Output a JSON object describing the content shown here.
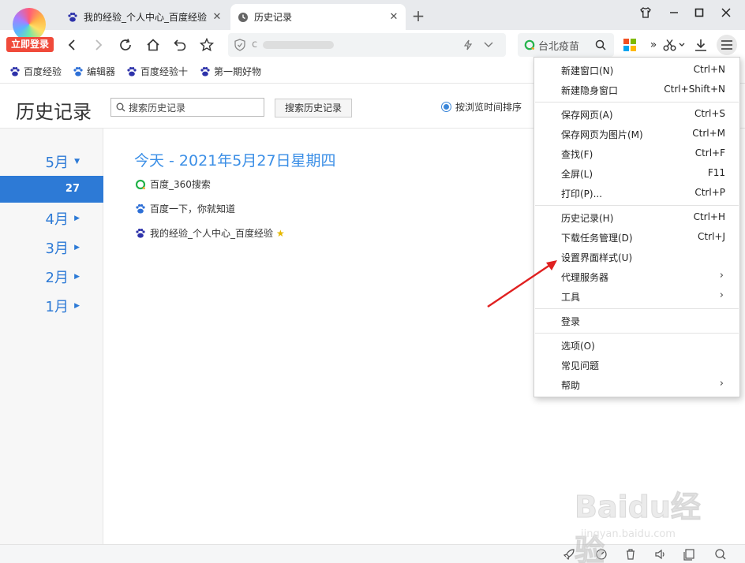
{
  "badge": {
    "login": "立即登录"
  },
  "tabs": [
    {
      "title": "我的经验_个人中心_百度经验",
      "icon": "baidu-paw-icon"
    },
    {
      "title": "历史记录",
      "icon": "clock-icon"
    }
  ],
  "toolbar": {
    "address_text": "c",
    "search_text": "台北疫苗",
    "more_label": "»"
  },
  "bookmarks": [
    {
      "label": "百度经验"
    },
    {
      "label": "编辑器"
    },
    {
      "label": "百度经验十"
    },
    {
      "label": "第一期好物"
    }
  ],
  "history": {
    "title": "历史记录",
    "search_placeholder": "搜索历史记录",
    "search_button": "搜索历史记录",
    "sort_label": "按浏览时间排序",
    "months": [
      "5月",
      "4月",
      "3月",
      "2月",
      "1月"
    ],
    "selected_day": "27",
    "date_heading": "今天 - 2021年5月27日星期四",
    "entries": [
      {
        "title": "百度_360搜索",
        "icon": "so360-icon"
      },
      {
        "title": "百度一下，你就知道",
        "icon": "baidu-paw-icon"
      },
      {
        "title": "我的经验_个人中心_百度经验",
        "icon": "baidu-paw-icon"
      }
    ]
  },
  "menu": {
    "items": [
      {
        "label": "新建窗口(N)",
        "shortcut": "Ctrl+N"
      },
      {
        "label": "新建隐身窗口",
        "shortcut": "Ctrl+Shift+N"
      },
      {
        "label": "保存网页(A)",
        "shortcut": "Ctrl+S"
      },
      {
        "label": "保存网页为图片(M)",
        "shortcut": "Ctrl+M"
      },
      {
        "label": "查找(F)",
        "shortcut": "Ctrl+F"
      },
      {
        "label": "全屏(L)",
        "shortcut": "F11"
      },
      {
        "label": "打印(P)...",
        "shortcut": "Ctrl+P"
      },
      {
        "label": "历史记录(H)",
        "shortcut": "Ctrl+H"
      },
      {
        "label": "下载任务管理(D)",
        "shortcut": "Ctrl+J"
      },
      {
        "label": "设置界面样式(U)",
        "shortcut": ""
      },
      {
        "label": "代理服务器",
        "shortcut": ""
      },
      {
        "label": "工具",
        "shortcut": ""
      },
      {
        "label": "登录",
        "shortcut": ""
      },
      {
        "label": "选项(O)",
        "shortcut": ""
      },
      {
        "label": "常见问题",
        "shortcut": ""
      },
      {
        "label": "帮助",
        "shortcut": ""
      }
    ]
  },
  "watermark": {
    "brand": "Baidu经验",
    "url": "jingyan.baidu.com"
  },
  "colors": {
    "accent": "#2d7ad6",
    "heading": "#3a8ee6",
    "badge": "#f04a3a",
    "annotation_arrow": "#e02020"
  }
}
